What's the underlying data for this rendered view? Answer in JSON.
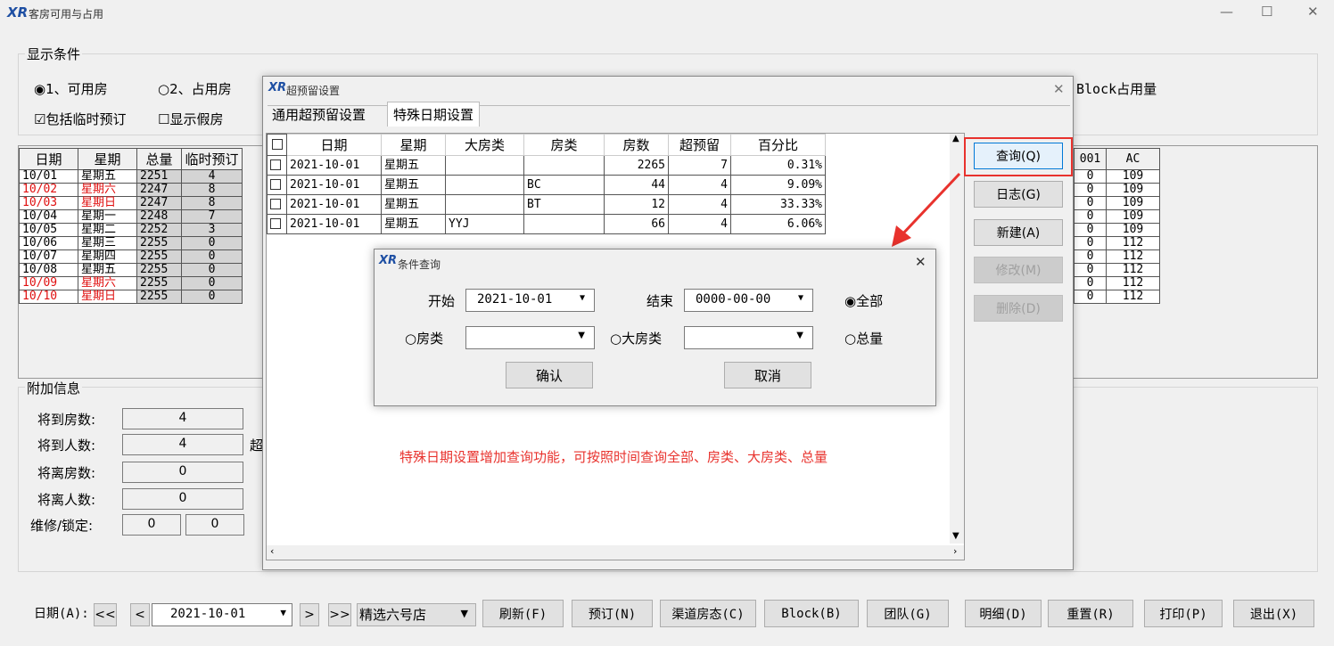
{
  "window": {
    "title": "客房可用与占用",
    "controls": [
      "—",
      "☐",
      "✕"
    ]
  },
  "display": {
    "legend": "显示条件",
    "radio1": "1、可用房",
    "radio2": "2、占用房",
    "chk1": "包括临时预订",
    "chk2": "显示假房",
    "block_label": "Block占用量"
  },
  "main_table": {
    "headers": [
      "日期",
      "星期",
      "总量",
      "临时预订"
    ],
    "rows": [
      {
        "date": "10/01",
        "day": "星期五",
        "total": "2251",
        "temp": "4",
        "red": false
      },
      {
        "date": "10/02",
        "day": "星期六",
        "total": "2247",
        "temp": "8",
        "red": true
      },
      {
        "date": "10/03",
        "day": "星期日",
        "total": "2247",
        "temp": "8",
        "red": true
      },
      {
        "date": "10/04",
        "day": "星期一",
        "total": "2248",
        "temp": "7",
        "red": false
      },
      {
        "date": "10/05",
        "day": "星期二",
        "total": "2252",
        "temp": "3",
        "red": false
      },
      {
        "date": "10/06",
        "day": "星期三",
        "total": "2255",
        "temp": "0",
        "red": false
      },
      {
        "date": "10/07",
        "day": "星期四",
        "total": "2255",
        "temp": "0",
        "red": false
      },
      {
        "date": "10/08",
        "day": "星期五",
        "total": "2255",
        "temp": "0",
        "red": false
      },
      {
        "date": "10/09",
        "day": "星期六",
        "total": "2255",
        "temp": "0",
        "red": true
      },
      {
        "date": "10/10",
        "day": "星期日",
        "total": "2255",
        "temp": "0",
        "red": true
      }
    ],
    "right_headers": [
      "001",
      "AC"
    ],
    "right_rows": [
      [
        "0",
        "109"
      ],
      [
        "0",
        "109"
      ],
      [
        "0",
        "109"
      ],
      [
        "0",
        "109"
      ],
      [
        "0",
        "109"
      ],
      [
        "0",
        "112"
      ],
      [
        "0",
        "112"
      ],
      [
        "0",
        "112"
      ],
      [
        "0",
        "112"
      ],
      [
        "0",
        "112"
      ]
    ]
  },
  "extra": {
    "legend": "附加信息",
    "arr_rooms_label": "将到房数:",
    "arr_rooms": "4",
    "arr_people_label": "将到人数:",
    "arr_people": "4",
    "chao": "超",
    "dep_rooms_label": "将离房数:",
    "dep_rooms": "0",
    "dep_people_label": "将离人数:",
    "dep_people": "0",
    "maint_label": "维修/锁定:",
    "maint1": "0",
    "maint2": "0"
  },
  "bottom": {
    "date_label": "日期(A):",
    "prev2": "<<",
    "prev": "<",
    "date": "2021-10-01",
    "next": ">",
    "next2": ">>",
    "hotel": "精选六号店",
    "buttons": [
      "刷新(F)",
      "预订(N)",
      "渠道房态(C)",
      "Block(B)",
      "团队(G)",
      "明细(D)",
      "重置(R)",
      "打印(P)",
      "退出(X)"
    ]
  },
  "over": {
    "title": "超预留设置",
    "tab1": "通用超预留设置",
    "tab2": "特殊日期设置",
    "headers": [
      "日期",
      "星期",
      "大房类",
      "房类",
      "房数",
      "超预留",
      "百分比"
    ],
    "rows": [
      {
        "date": "2021-10-01",
        "day": "星期五",
        "big": "",
        "type": "",
        "rooms": "2265",
        "over": "7",
        "pct": "0.31%"
      },
      {
        "date": "2021-10-01",
        "day": "星期五",
        "big": "",
        "type": "BC",
        "rooms": "44",
        "over": "4",
        "pct": "9.09%"
      },
      {
        "date": "2021-10-01",
        "day": "星期五",
        "big": "",
        "type": "BT",
        "rooms": "12",
        "over": "4",
        "pct": "33.33%"
      },
      {
        "date": "2021-10-01",
        "day": "星期五",
        "big": "YYJ",
        "type": "",
        "rooms": "66",
        "over": "4",
        "pct": "6.06%"
      }
    ],
    "btn_query": "查询(Q)",
    "btn_log": "日志(G)",
    "btn_new": "新建(A)",
    "btn_edit": "修改(M)",
    "btn_delete": "删除(D)",
    "annotation": "特殊日期设置增加查询功能，可按照时间查询全部、房类、大房类、总量"
  },
  "query": {
    "title": "条件查询",
    "start_label": "开始",
    "start": "2021-10-01",
    "end_label": "结束",
    "end": "0000-00-00",
    "all": "全部",
    "room_type": "房类",
    "big_type": "大房类",
    "total": "总量",
    "ok": "确认",
    "cancel": "取消"
  },
  "colors": {
    "annotation": "#e8322d",
    "highlight": "#e8322d",
    "red_row": "#e01010"
  }
}
